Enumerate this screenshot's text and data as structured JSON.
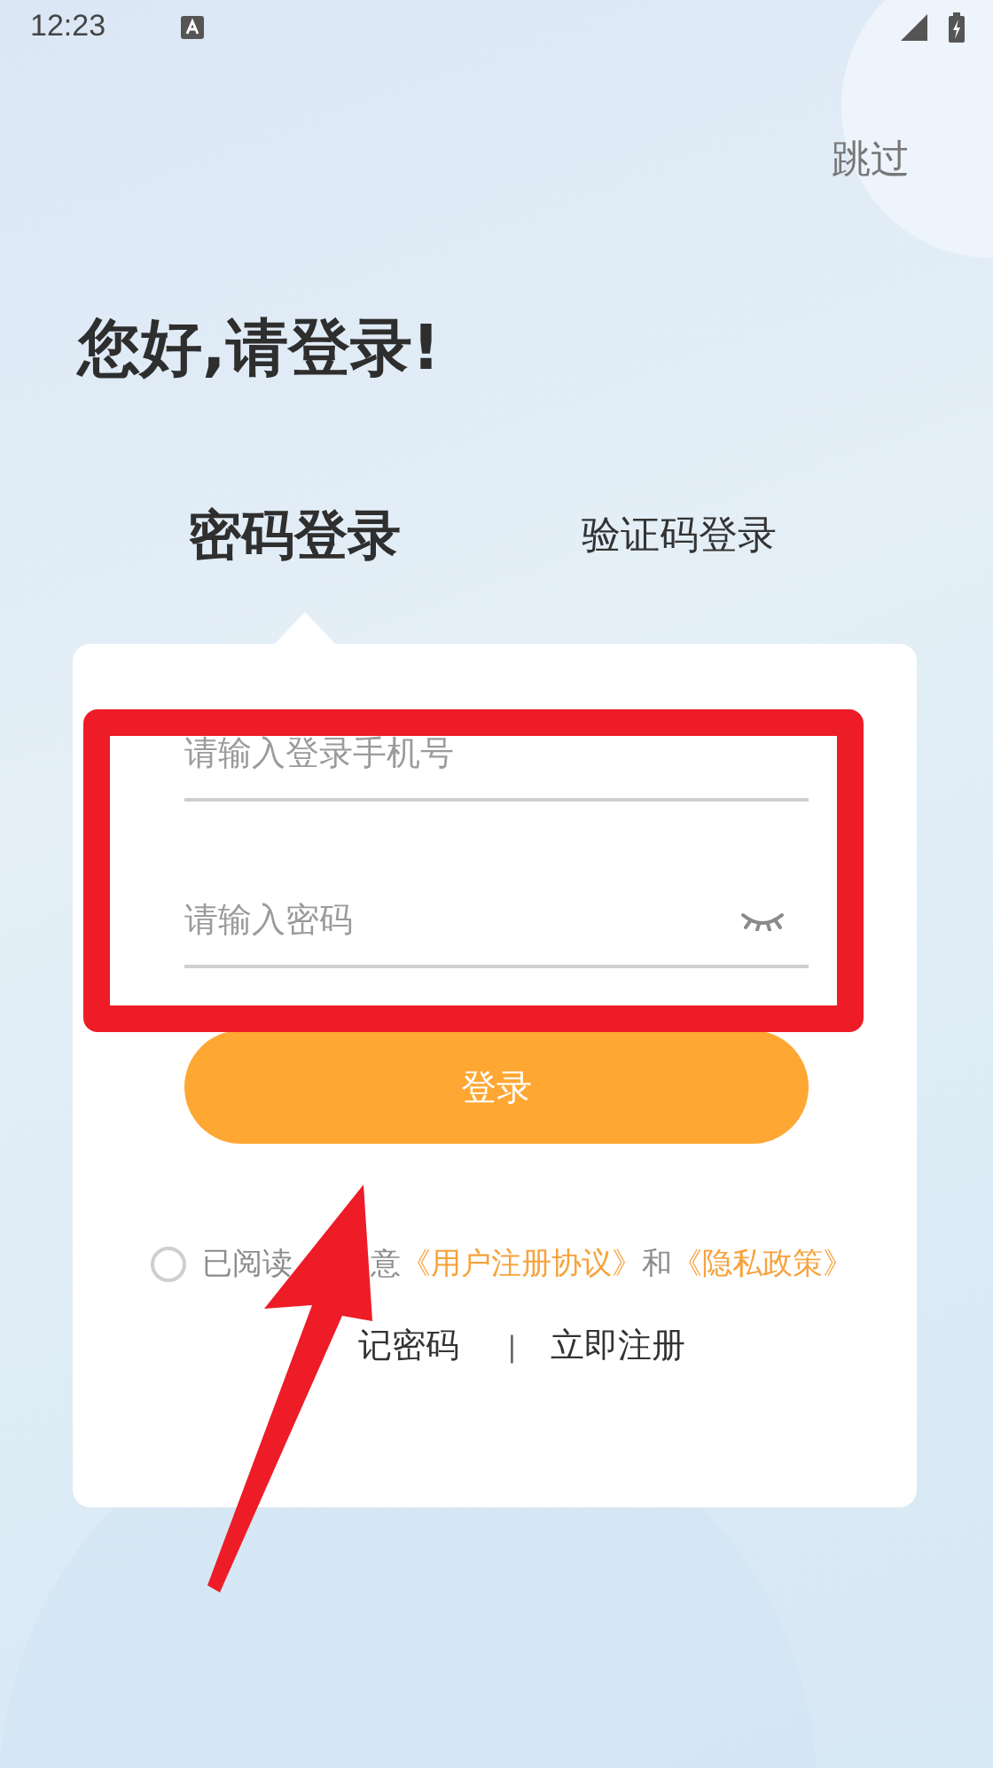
{
  "status_bar": {
    "time": "12:23"
  },
  "skip": "跳过",
  "greeting": "您好,请登录!",
  "tabs": [
    {
      "label": "密码登录",
      "selected": true
    },
    {
      "label": "验证码登录",
      "selected": false
    }
  ],
  "fields": [
    {
      "placeholder": "请输入登录手机号",
      "kind": "phone"
    },
    {
      "placeholder": "请输入密码",
      "kind": "password"
    }
  ],
  "login_button": "登录",
  "agreement": {
    "checked": false,
    "parts": [
      {
        "text": "已阅读",
        "kind": "plain"
      },
      {
        "text": "意",
        "kind": "plain"
      },
      {
        "text": "《用户注册协议》",
        "kind": "link"
      },
      {
        "text": "和",
        "kind": "plain"
      },
      {
        "text": "《隐私政策》",
        "kind": "link"
      }
    ]
  },
  "links": [
    {
      "label": "记密码"
    },
    {
      "label": "立即注册"
    }
  ],
  "separator": "|"
}
